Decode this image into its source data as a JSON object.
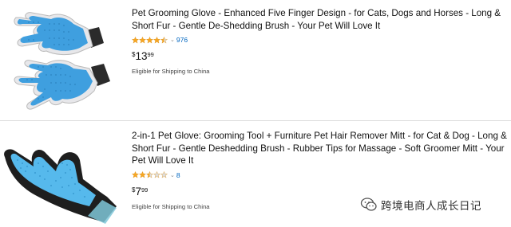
{
  "results": [
    {
      "title": "Pet Grooming Glove - Enhanced Five Finger Design - for Cats, Dogs and Horses - Long & Short Fur - Gentle De-Shedding Brush - Your Pet Will Love It",
      "rating": 4.5,
      "rating_max": 5,
      "review_count": "976",
      "price": {
        "currency": "$",
        "whole": "13",
        "fraction": "99"
      },
      "shipping": "Eligible for Shipping to China",
      "image_icon": "blue-five-finger-grooming-gloves-pair"
    },
    {
      "title": "2-in-1 Pet Glove: Grooming Tool + Furniture Pet Hair Remover Mitt - for Cat & Dog - Long & Short Fur - Gentle Deshedding Brush - Rubber Tips for Massage - Soft Groomer Mitt - Your Pet Will Love It",
      "rating": 2.5,
      "rating_max": 5,
      "review_count": "8",
      "price": {
        "currency": "$",
        "whole": "7",
        "fraction": "99"
      },
      "shipping": "Eligible for Shipping to China",
      "image_icon": "blue-black-grooming-mitt"
    }
  ],
  "watermark": {
    "text": "跨境电商人成长日记",
    "icon": "wechat-logo-icon"
  },
  "colors": {
    "star": "#f6a623",
    "star_empty": "#dddddd",
    "link": "#0066c0",
    "glove_blue": "#3f9fdf"
  }
}
